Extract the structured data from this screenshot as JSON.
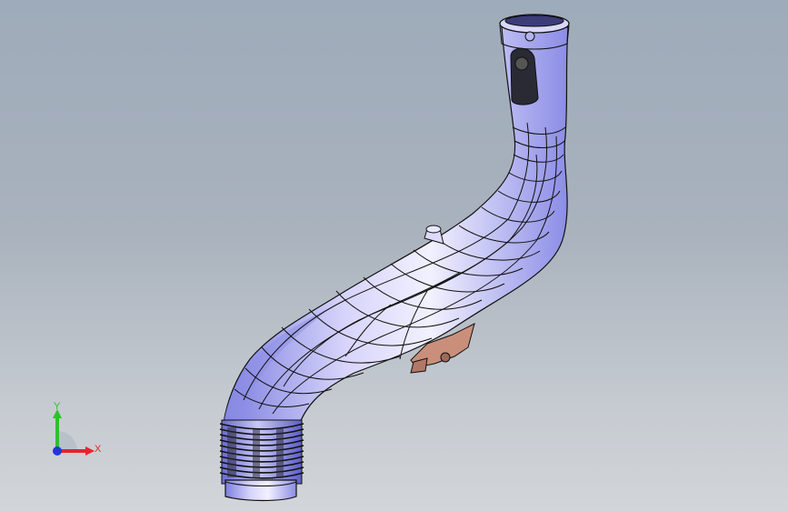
{
  "viewport": {
    "background_top": "#9eabba",
    "background_bottom": "#d2d5d9"
  },
  "model": {
    "body_color": "#c9c8f6",
    "shadow_color": "#6e6fd8",
    "edge_color": "#111111",
    "bracket_color": "#c98f7b"
  },
  "triad": {
    "x_label": "X",
    "y_label": "Y",
    "x_color": "#e3262b",
    "y_color": "#2fbf2f",
    "z_color": "#2436d8"
  }
}
